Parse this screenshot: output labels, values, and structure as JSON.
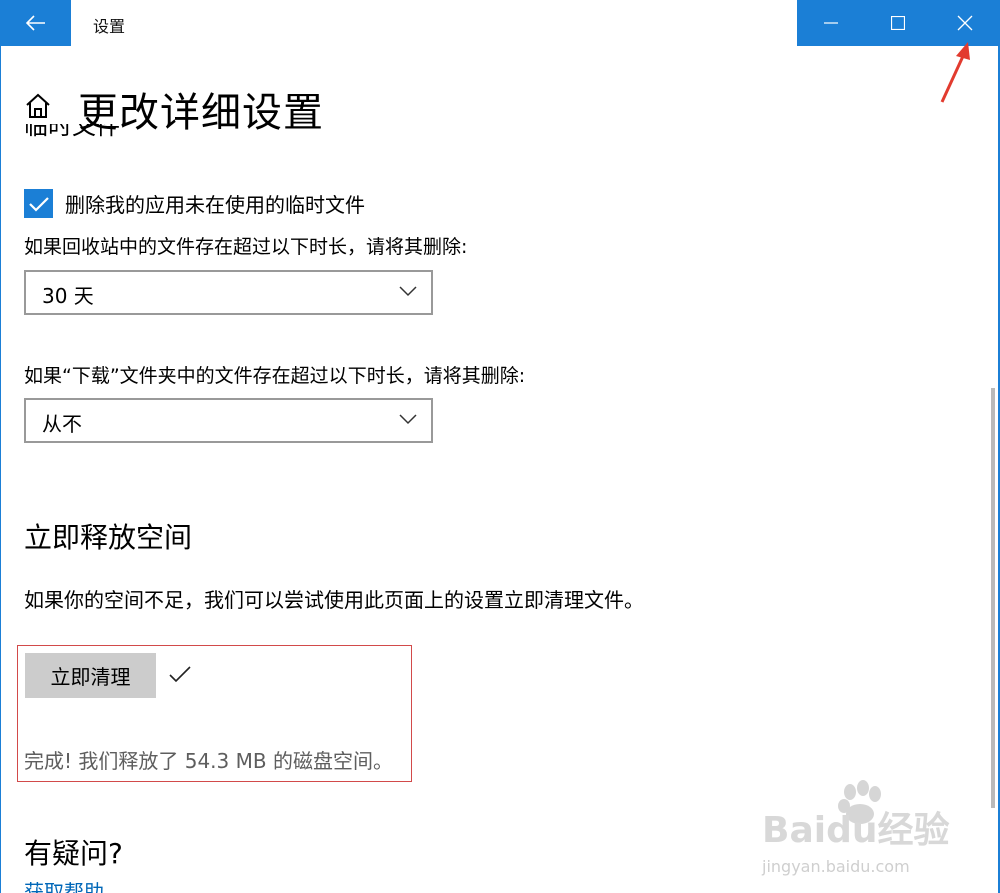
{
  "window": {
    "app_title": "设置"
  },
  "page": {
    "title": "更改详细设置",
    "partial_heading": "临时文件"
  },
  "temp_files": {
    "checkbox_label": "删除我的应用未在使用的临时文件",
    "checkbox_checked": true,
    "recycle_label": "如果回收站中的文件存在超过以下时长，请将其删除:",
    "recycle_value": "30 天",
    "downloads_label": "如果“下载”文件夹中的文件存在超过以下时长，请将其删除:",
    "downloads_value": "从不"
  },
  "free_space": {
    "title": "立即释放空间",
    "description": "如果你的空间不足，我们可以尝试使用此页面上的设置立即清理文件。",
    "button_label": "立即清理",
    "result_text": "完成! 我们释放了 54.3 MB 的磁盘空间。"
  },
  "help": {
    "title": "有疑问?",
    "link_text": "获取帮助"
  },
  "watermark": {
    "text": "Baidu经验",
    "url_text": "jingyan.baidu.com"
  },
  "colors": {
    "accent": "#1b7fd6",
    "highlight_border": "#d24a4a",
    "arrow": "#e23b2f",
    "link": "#0067b8"
  },
  "icons": [
    "back-arrow-icon",
    "minimize-icon",
    "maximize-icon",
    "close-icon",
    "home-icon",
    "checkmark-icon",
    "chevron-down-icon",
    "red-arrow-annotation"
  ]
}
